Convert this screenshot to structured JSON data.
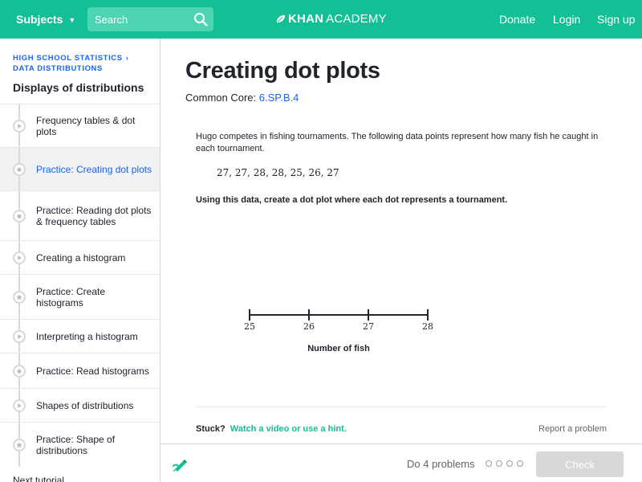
{
  "header": {
    "subjects_label": "Subjects",
    "search_placeholder": "Search",
    "logo_bold": "KHAN",
    "logo_regular": "ACADEMY",
    "donate_label": "Donate",
    "login_label": "Login",
    "signup_label": "Sign up"
  },
  "colors": {
    "brand_green": "#14bf96",
    "link_blue": "#1865f2"
  },
  "sidebar": {
    "breadcrumb_course": "HIGH SCHOOL STATISTICS",
    "breadcrumb_unit": "DATA DISTRIBUTIONS",
    "title": "Displays of distributions",
    "items": [
      {
        "label": "Frequency tables & dot plots",
        "icon": "play-icon",
        "active": false
      },
      {
        "label": "Practice: Creating dot plots",
        "icon": "star-icon",
        "active": true
      },
      {
        "label": "Practice: Reading dot plots & frequency tables",
        "icon": "star-icon",
        "active": false
      },
      {
        "label": "Creating a histogram",
        "icon": "play-icon",
        "active": false
      },
      {
        "label": "Practice: Create histograms",
        "icon": "star-icon",
        "active": false
      },
      {
        "label": "Interpreting a histogram",
        "icon": "play-icon",
        "active": false
      },
      {
        "label": "Practice: Read histograms",
        "icon": "star-icon",
        "active": false
      },
      {
        "label": "Shapes of distributions",
        "icon": "play-icon",
        "active": false
      },
      {
        "label": "Practice: Shape of distributions",
        "icon": "star-icon",
        "active": false
      }
    ],
    "next_tutorial": "Next tutorial"
  },
  "main": {
    "title": "Creating dot plots",
    "common_core_label": "Common Core:",
    "common_core_code": "6.SP.B.4",
    "problem_text": "Hugo competes in fishing tournaments. The following data points represent how many fish he caught in each tournament.",
    "dataset": "27, 27, 28, 28, 25, 26, 27",
    "instruction": "Using this data, create a dot plot where each dot represents a tournament.",
    "number_line": {
      "ticks": [
        "25",
        "26",
        "27",
        "28"
      ],
      "label": "Number of fish"
    },
    "stuck_label": "Stuck?",
    "hint_label": "Watch a video or use a hint.",
    "report_label": "Report a problem"
  },
  "footer": {
    "progress_label": "Do 4 problems",
    "progress_dots": 4,
    "check_label": "Check"
  }
}
